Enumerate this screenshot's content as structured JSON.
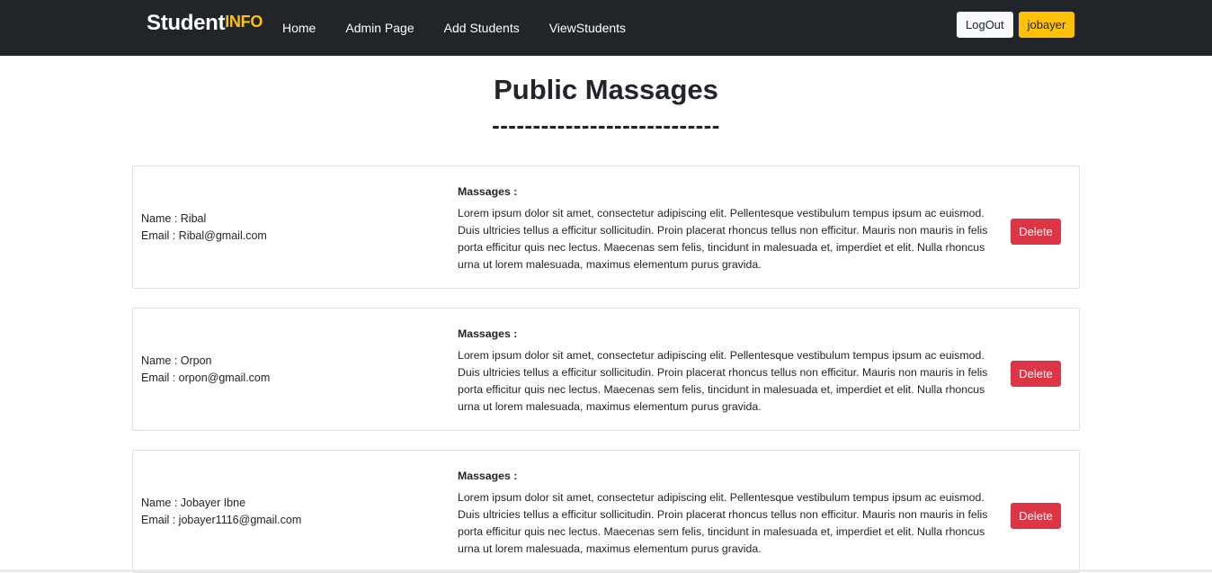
{
  "navbar": {
    "brand_main": "Student",
    "brand_accent": "INFO",
    "links": [
      "Home",
      "Admin Page",
      "Add Students",
      "ViewStudents"
    ],
    "logout_label": "LogOut",
    "user_label": "jobayer"
  },
  "page": {
    "title": "Public Massages",
    "rule": "----------------------------"
  },
  "messages": [
    {
      "name": "Name : Ribal",
      "email": "Email : Ribal@gmail.com",
      "label": "Massages :",
      "body": "Lorem ipsum dolor sit amet, consectetur adipiscing elit. Pellentesque vestibulum tempus ipsum ac euismod. Duis ultricies tellus a efficitur sollicitudin. Proin placerat rhoncus tellus non efficitur. Mauris non mauris in felis porta efficitur quis nec lectus. Maecenas sem felis, tincidunt in malesuada et, imperdiet et elit. Nulla rhoncus urna ut lorem malesuada, maximus elementum purus gravida.",
      "delete_label": "Delete"
    },
    {
      "name": "Name : Orpon",
      "email": "Email : orpon@gmail.com",
      "label": "Massages :",
      "body": "Lorem ipsum dolor sit amet, consectetur adipiscing elit. Pellentesque vestibulum tempus ipsum ac euismod. Duis ultricies tellus a efficitur sollicitudin. Proin placerat rhoncus tellus non efficitur. Mauris non mauris in felis porta efficitur quis nec lectus. Maecenas sem felis, tincidunt in malesuada et, imperdiet et elit. Nulla rhoncus urna ut lorem malesuada, maximus elementum purus gravida.",
      "delete_label": "Delete"
    },
    {
      "name": "Name : Jobayer Ibne",
      "email": "Email : jobayer1116@gmail.com",
      "label": "Massages :",
      "body": "Lorem ipsum dolor sit amet, consectetur adipiscing elit. Pellentesque vestibulum tempus ipsum ac euismod. Duis ultricies tellus a efficitur sollicitudin. Proin placerat rhoncus tellus non efficitur. Mauris non mauris in felis porta efficitur quis nec lectus. Maecenas sem felis, tincidunt in malesuada et, imperdiet et elit. Nulla rhoncus urna ut lorem malesuada, maximus elementum purus gravida.",
      "delete_label": "Delete"
    }
  ],
  "colors": {
    "navbar_bg": "#212529",
    "brand_accent": "#ffc107",
    "delete_button": "#dc3545",
    "user_button": "#ffc107"
  }
}
